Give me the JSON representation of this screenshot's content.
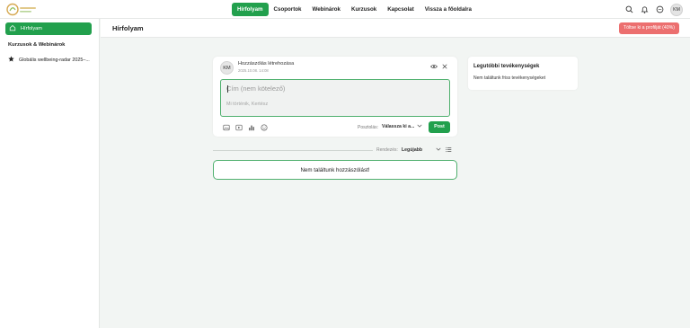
{
  "nav": {
    "items": [
      {
        "label": "Hírfolyam",
        "active": true
      },
      {
        "label": "Csoportok",
        "active": false
      },
      {
        "label": "Webinárok",
        "active": false
      },
      {
        "label": "Kurzusok",
        "active": false
      },
      {
        "label": "Kapcsolat",
        "active": false
      },
      {
        "label": "Vissza a főoldalra",
        "active": false
      }
    ],
    "user_initials": "KM",
    "icons": [
      "search-icon",
      "bell-icon",
      "chat-icon"
    ]
  },
  "sidebar": {
    "active_item": "Hírfolyam",
    "section_title": "Kurzusok & Webinárok",
    "courses": [
      "Globális wellbeing-radar 2025–..."
    ]
  },
  "header": {
    "title": "Hírfolyam",
    "profile_button": "Töltse ki a profilját (40%)"
  },
  "composer": {
    "avatar_initials": "KM",
    "title": "Hozzászólás létrehozása",
    "date": "2025.10.08. 14:08",
    "title_placeholder": "Cím (nem kötelező)",
    "body_placeholder": "Mi történik, Kertész",
    "post_to_label": "Posztolás:",
    "post_to_value": "Válassza ki a...",
    "post_button": "Post"
  },
  "feed": {
    "sort_label": "Rendezés:",
    "sort_value": "Legújabb",
    "empty_message": "Nem találtunk hozzászólást!"
  },
  "activity": {
    "title": "Legutóbbi tevékenységek",
    "empty_message": "Nem találtunk friss tevékenységeket"
  },
  "colors": {
    "brand_green": "#22a04d",
    "profile_red": "#ec6f6f",
    "background": "#f2f5f3"
  }
}
